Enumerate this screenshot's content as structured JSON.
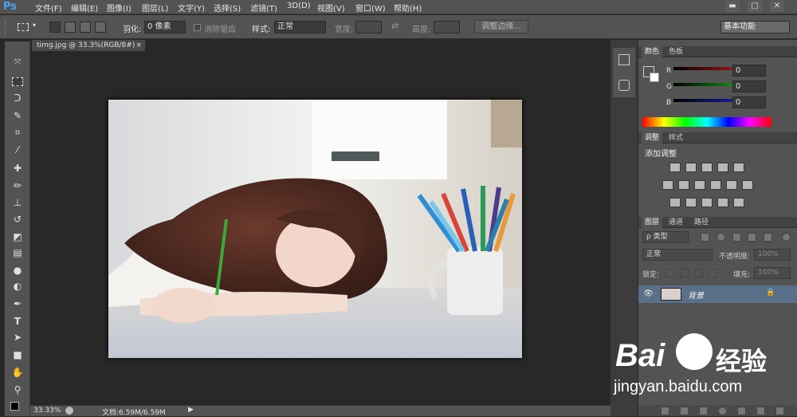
{
  "app": {
    "logo": "Ps",
    "menu": [
      "文件(F)",
      "编辑(E)",
      "图像(I)",
      "图层(L)",
      "文字(Y)",
      "选择(S)",
      "滤镜(T)",
      "3D(D)",
      "视图(V)",
      "窗口(W)",
      "帮助(H)"
    ],
    "window_buttons": [
      "▬",
      "□",
      "✕"
    ]
  },
  "options": {
    "feather_label": "羽化:",
    "feather_value": "0 像素",
    "antialias_label": "消除锯齿",
    "style_label": "样式:",
    "style_value": "正常",
    "width_label": "宽度:",
    "height_label": "高度:",
    "refine_button": "调整边缘...",
    "workspace": "基本功能"
  },
  "document": {
    "tab_title": "timg.jpg @ 33.3%(RGB/8#)",
    "close": "×"
  },
  "status": {
    "zoom": "33.33%",
    "doc_info": "文档:6.59M/6.59M"
  },
  "color_panel": {
    "tabs": [
      "颜色",
      "色板"
    ],
    "r_label": "R",
    "r": "0",
    "g_label": "G",
    "g": "0",
    "b_label": "B",
    "b": "0",
    "fg_color": "#000000",
    "bg_color": "#ffffff"
  },
  "adjust_panel": {
    "tabs": [
      "调整",
      "样式"
    ],
    "title": "添加调整"
  },
  "layers_panel": {
    "tabs": [
      "图层",
      "通道",
      "路径"
    ],
    "filter": "ρ 类型",
    "blend_mode": "正常",
    "opacity_label": "不透明度:",
    "opacity_value": "100%",
    "lock_label": "锁定:",
    "fill_label": "填充:",
    "fill_value": "100%",
    "layer_name": "背景"
  },
  "watermark": {
    "brand": "Bai",
    "brand2": "经验",
    "url": "jingyan.baidu.com"
  }
}
